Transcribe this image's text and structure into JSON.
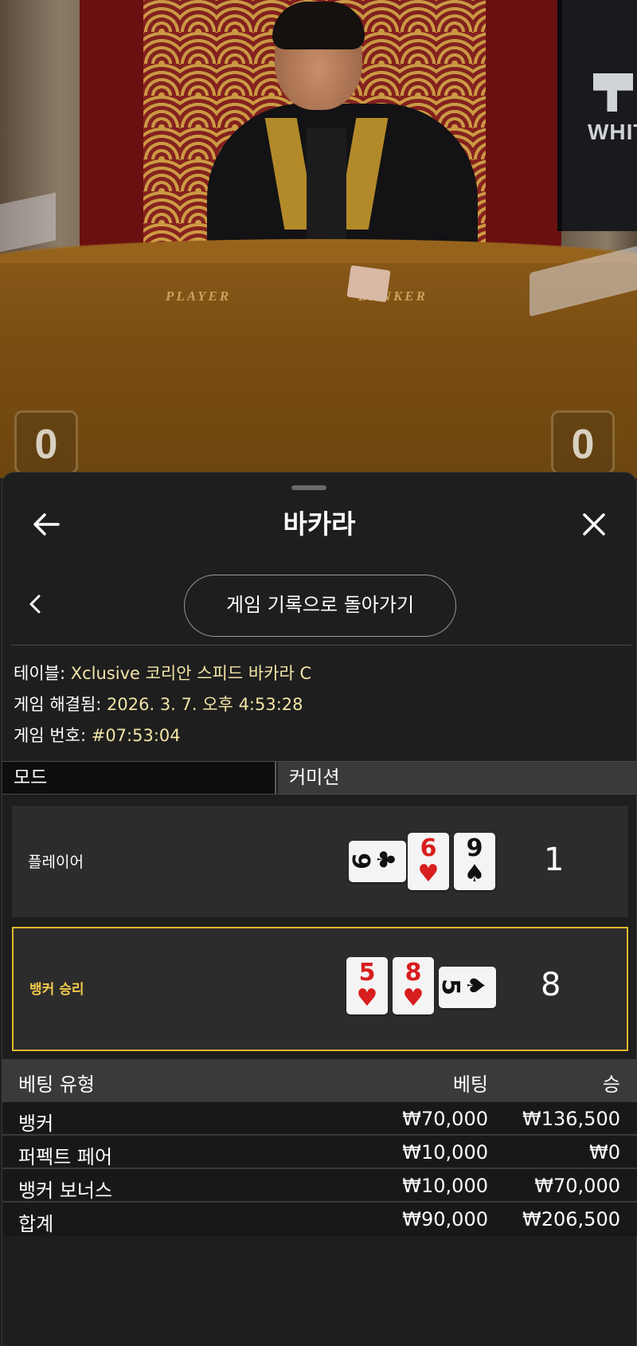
{
  "video": {
    "player_label": "PLAYER",
    "banker_label": "BANKER",
    "monitor_text": "WHIT",
    "player_score": "0",
    "banker_score": "0"
  },
  "header": {
    "title": "바카라",
    "back_icon": "arrow-left-icon",
    "close_icon": "close-icon"
  },
  "history_button": "게임 기록으로 돌아가기",
  "info": {
    "table_label": "테이블: ",
    "table_value": "Xclusive 코리안 스피드 바카라 C",
    "resolved_label": "게임 해결됨: ",
    "resolved_value": "2026. 3. 7. 오후 4:53:28",
    "number_label": "게임 번호: ",
    "number_value": "#07:53:04"
  },
  "tabs": {
    "mode": "모드",
    "commission": "커미션"
  },
  "hands": {
    "player": {
      "label": "플레이어",
      "score": "1",
      "cards": [
        {
          "rank": "9",
          "suit": "♣",
          "color": "#111111",
          "orientation": "horizontal"
        },
        {
          "rank": "6",
          "suit": "♥",
          "color": "#d81e1e",
          "orientation": "vertical"
        },
        {
          "rank": "9",
          "suit": "♠",
          "color": "#111111",
          "orientation": "vertical"
        }
      ]
    },
    "banker": {
      "label": "뱅커 승리",
      "score": "8",
      "cards": [
        {
          "rank": "5",
          "suit": "♥",
          "color": "#d81e1e",
          "orientation": "vertical"
        },
        {
          "rank": "8",
          "suit": "♥",
          "color": "#d81e1e",
          "orientation": "vertical"
        },
        {
          "rank": "5",
          "suit": "♠",
          "color": "#111111",
          "orientation": "horizontal"
        }
      ]
    }
  },
  "bets": {
    "headers": {
      "type": "베팅 유형",
      "bet": "베팅",
      "win": "승"
    },
    "rows": [
      {
        "type": "뱅커",
        "bet": "₩70,000",
        "win": "₩136,500"
      },
      {
        "type": "퍼펙트 페어",
        "bet": "₩10,000",
        "win": "₩0"
      },
      {
        "type": "뱅커 보너스",
        "bet": "₩10,000",
        "win": "₩70,000"
      }
    ],
    "total": {
      "type": "합계",
      "bet": "₩90,000",
      "win": "₩206,500"
    }
  },
  "colors": {
    "accent_gold": "#e0b92a",
    "info_value": "#f2e4a6",
    "card_red": "#d81e1e"
  }
}
